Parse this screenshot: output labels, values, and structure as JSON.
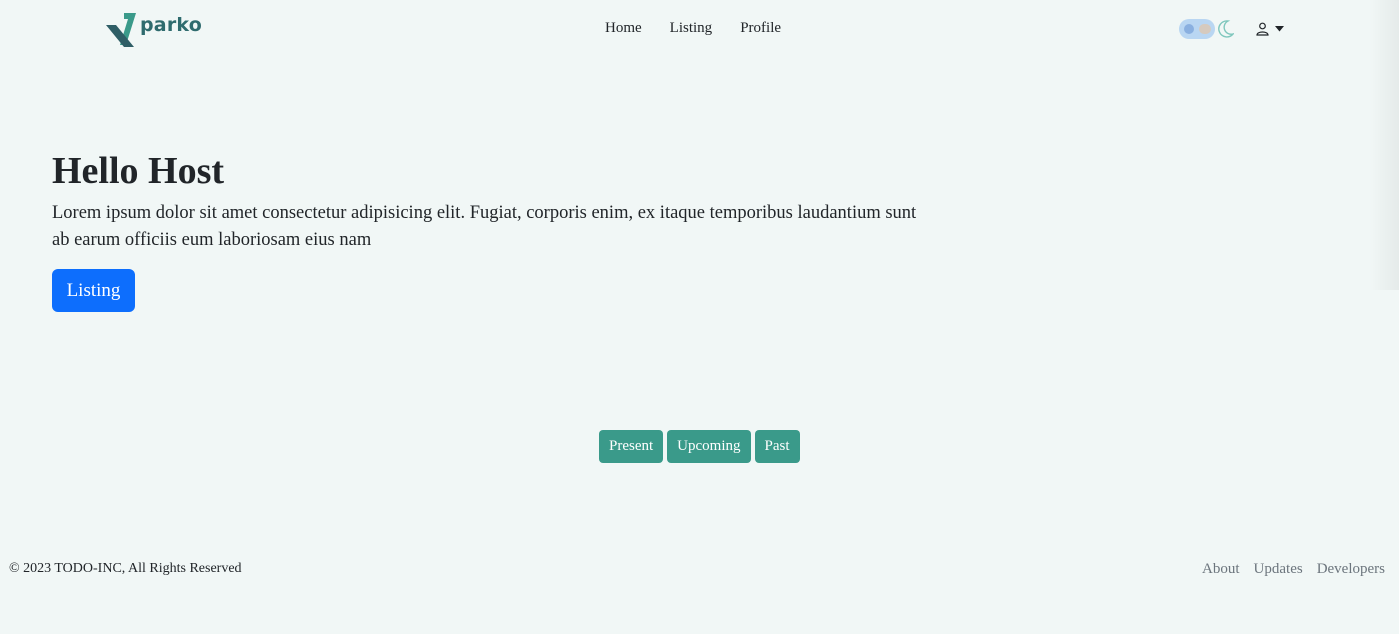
{
  "brand": {
    "name": "parko",
    "logo_icon": "parko-logo-icon",
    "color": "#2f6b6e"
  },
  "nav": {
    "items": [
      {
        "label": "Home"
      },
      {
        "label": "Listing"
      },
      {
        "label": "Profile"
      }
    ]
  },
  "header_controls": {
    "theme_toggle_icon": "toggle-switch-icon",
    "moon_icon": "moon-icon",
    "user_icon": "user-icon",
    "caret_icon": "caret-down-icon"
  },
  "hero": {
    "title": "Hello Host",
    "text": "Lorem ipsum dolor sit amet consectetur adipisicing elit. Fugiat, corporis enim, ex itaque temporibus laudantium sunt ab earum officiis eum laboriosam eius nam",
    "button_label": "Listing",
    "button_color": "#0d6efd"
  },
  "filters": {
    "color": "#3a9a8a",
    "items": [
      {
        "label": "Present"
      },
      {
        "label": "Upcoming"
      },
      {
        "label": "Past"
      }
    ]
  },
  "footer": {
    "copyright": "© 2023 TODO-INC, All Rights Reserved",
    "links": [
      {
        "label": "About"
      },
      {
        "label": "Updates"
      },
      {
        "label": "Developers"
      }
    ]
  },
  "colors": {
    "background": "#f1f7f6",
    "text": "#212529",
    "muted": "#6c757d"
  }
}
